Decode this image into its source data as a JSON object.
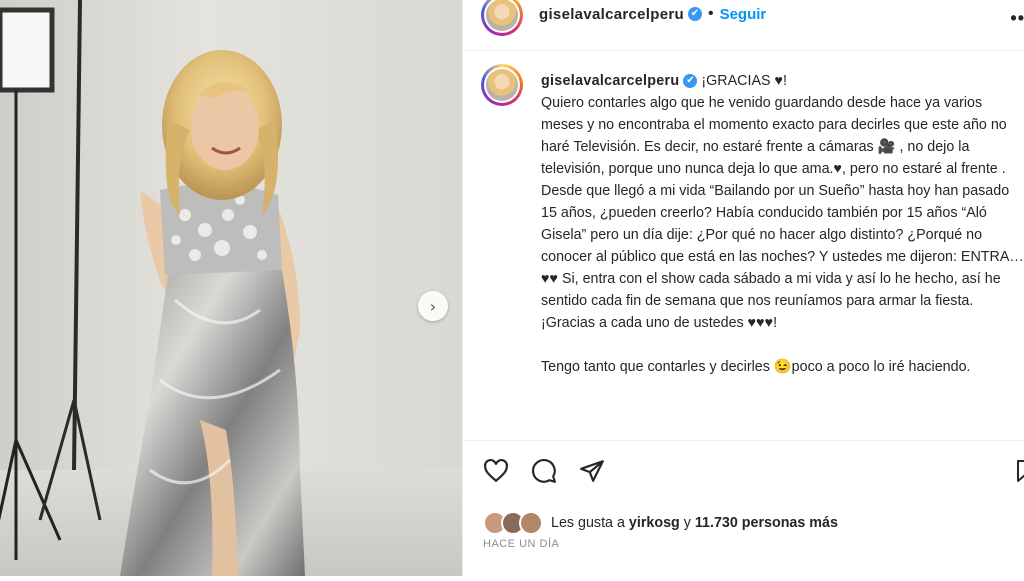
{
  "post": {
    "username": "giselavalcarcelperu",
    "follow_label": "Seguir",
    "more_label": "••",
    "separator": "•"
  },
  "caption": {
    "username": "giselavalcarcelperu",
    "paragraphs": [
      "¡GRACIAS ♥!",
      "Quiero contarles algo que he venido guardando desde hace ya varios meses y no encontraba el momento exacto para decirles que este año no haré Televisión. Es decir, no estaré frente a cámaras 🎥 , no dejo la televisión, porque uno nunca deja lo que ama.♥, pero no estaré al frente .",
      "Desde que llegó a mi vida “Bailando por un Sueño” hasta hoy han pasado 15 años, ¿pueden creerlo? Había conducido también por 15 años “Aló Gisela” pero un día dije: ¿Por qué no hacer algo distinto? ¿Porqué no conocer al público que está en las noches? Y ustedes me dijeron: ENTRA…♥♥ Si, entra con el show cada sábado a mi vida y así lo he hecho, así he sentido cada fin de semana que nos reuníamos para armar la fiesta.",
      "¡Gracias a cada uno de ustedes ♥♥♥!",
      "",
      "Tengo tanto que contarles y decirles 😉poco a poco lo iré haciendo."
    ]
  },
  "likes": {
    "prefix": "Les gusta a ",
    "user": "yirkosg",
    "middle": " y ",
    "count": "11.730 personas más"
  },
  "timestamp": "HACE UN DÍA",
  "icons": {
    "next": "›",
    "verified": "✔"
  },
  "colors": {
    "accent": "#0095f6",
    "verified": "#3897f0",
    "text": "#262626",
    "muted": "#8e8e8e"
  }
}
